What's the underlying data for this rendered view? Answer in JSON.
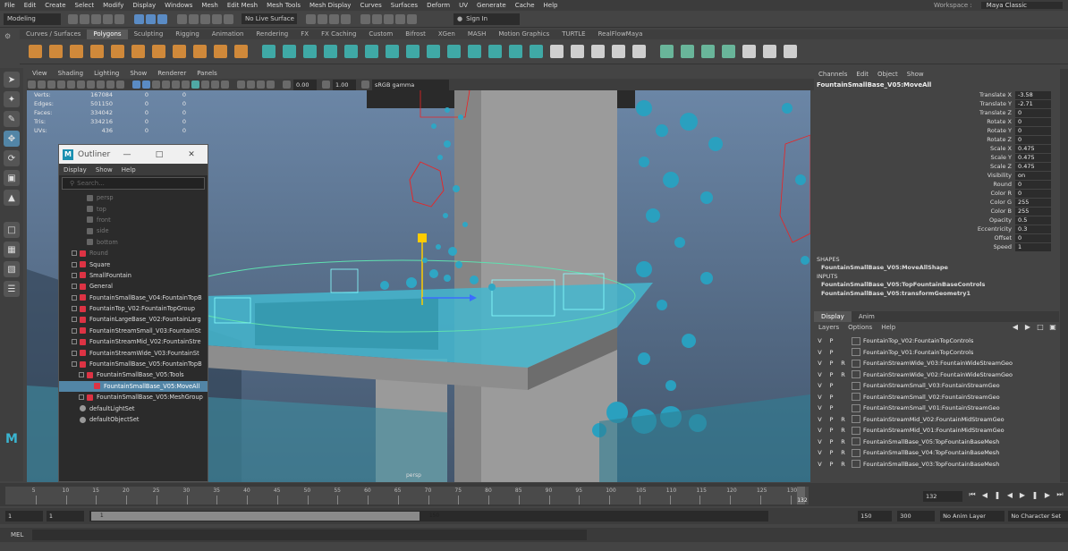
{
  "menubar": {
    "items": [
      "File",
      "Edit",
      "Create",
      "Select",
      "Modify",
      "Display",
      "Windows",
      "Mesh",
      "Edit Mesh",
      "Mesh Tools",
      "Mesh Display",
      "Curves",
      "Surfaces",
      "Deform",
      "UV",
      "Generate",
      "Cache",
      "Help"
    ],
    "workspace_label": "Workspace :",
    "workspace_value": "Maya Classic"
  },
  "statusline": {
    "mode": "Modeling",
    "live_surface": "No Live Surface",
    "sign_in": "Sign In"
  },
  "shelf": {
    "tabs": [
      "Curves / Surfaces",
      "Polygons",
      "Sculpting",
      "Rigging",
      "Animation",
      "Rendering",
      "FX",
      "FX Caching",
      "Custom",
      "Bifrost",
      "XGen",
      "MASH",
      "Motion Graphics",
      "TURTLE",
      "RealFlowMaya"
    ],
    "active_tab": "Polygons"
  },
  "viewport": {
    "menu": [
      "View",
      "Shading",
      "Lighting",
      "Show",
      "Renderer",
      "Panels"
    ],
    "field_a": "0.00",
    "field_b": "1.00",
    "colorspace": "sRGB gamma",
    "camera_label": "persp",
    "hud": [
      {
        "label": "Verts:",
        "a": "167084",
        "b": "0",
        "c": "0"
      },
      {
        "label": "Edges:",
        "a": "501150",
        "b": "0",
        "c": "0"
      },
      {
        "label": "Faces:",
        "a": "334042",
        "b": "0",
        "c": "0"
      },
      {
        "label": "Tris:",
        "a": "334216",
        "b": "0",
        "c": "0"
      },
      {
        "label": "UVs:",
        "a": "436",
        "b": "0",
        "c": "0"
      }
    ]
  },
  "outliner": {
    "title": "Outliner",
    "menu": [
      "Display",
      "Show",
      "Help"
    ],
    "search_placeholder": "Search...",
    "items": [
      {
        "label": "persp",
        "type": "cam",
        "dim": true,
        "indent": 1
      },
      {
        "label": "top",
        "type": "cam",
        "dim": true,
        "indent": 1
      },
      {
        "label": "front",
        "type": "cam",
        "dim": true,
        "indent": 1
      },
      {
        "label": "side",
        "type": "cam",
        "dim": true,
        "indent": 1
      },
      {
        "label": "bottom",
        "type": "cam",
        "dim": true,
        "indent": 1
      },
      {
        "label": "Round",
        "type": "grp",
        "dim": true,
        "indent": 0
      },
      {
        "label": "Square",
        "type": "grp",
        "dim": false,
        "indent": 0
      },
      {
        "label": "SmallFountain",
        "type": "grp",
        "dim": false,
        "indent": 0
      },
      {
        "label": "General",
        "type": "grp",
        "dim": false,
        "indent": 0
      },
      {
        "label": "FountainSmallBase_V04:FountainTopB",
        "type": "grp",
        "dim": false,
        "indent": 0
      },
      {
        "label": "FountainTop_V02:FountainTopGroup",
        "type": "grp",
        "dim": false,
        "indent": 0
      },
      {
        "label": "FountainLargeBase_V02:FountainLarg",
        "type": "grp",
        "dim": false,
        "indent": 0
      },
      {
        "label": "FountainStreamSmall_V03:FountainSt",
        "type": "grp",
        "dim": false,
        "indent": 0
      },
      {
        "label": "FountainStreamMid_V02:FountainStre",
        "type": "grp",
        "dim": false,
        "indent": 0
      },
      {
        "label": "FountainStreamWide_V03:FountainSt",
        "type": "grp",
        "dim": false,
        "indent": 0
      },
      {
        "label": "FountainSmallBase_V05:FountainTopB",
        "type": "grp",
        "dim": false,
        "indent": 0
      },
      {
        "label": "FountainSmallBase_V05:Tools",
        "type": "grp",
        "dim": false,
        "indent": 1
      },
      {
        "label": "FountainSmallBase_V05:MoveAll",
        "type": "tool",
        "dim": false,
        "indent": 2,
        "selected": true
      },
      {
        "label": "FountainSmallBase_V05:MeshGroup",
        "type": "grp",
        "dim": false,
        "indent": 1
      },
      {
        "label": "defaultLightSet",
        "type": "set",
        "dim": false,
        "indent": 0
      },
      {
        "label": "defaultObjectSet",
        "type": "set",
        "dim": false,
        "indent": 0
      }
    ]
  },
  "channelbox": {
    "menu": [
      "Channels",
      "Edit",
      "Object",
      "Show"
    ],
    "object_name": "FountainSmallBase_V05:MoveAll",
    "attributes": [
      {
        "name": "Translate X",
        "value": "-3.58"
      },
      {
        "name": "Translate Y",
        "value": "-2.71"
      },
      {
        "name": "Translate Z",
        "value": "0"
      },
      {
        "name": "Rotate X",
        "value": "0"
      },
      {
        "name": "Rotate Y",
        "value": "0"
      },
      {
        "name": "Rotate Z",
        "value": "0"
      },
      {
        "name": "Scale X",
        "value": "0.475"
      },
      {
        "name": "Scale Y",
        "value": "0.475"
      },
      {
        "name": "Scale Z",
        "value": "0.475"
      },
      {
        "name": "Visibility",
        "value": "on"
      },
      {
        "name": "Round",
        "value": "0"
      },
      {
        "name": "Color R",
        "value": "0"
      },
      {
        "name": "Color G",
        "value": "255"
      },
      {
        "name": "Color B",
        "value": "255"
      },
      {
        "name": "Opacity",
        "value": "0.5"
      },
      {
        "name": "Eccentricity",
        "value": "0.3"
      },
      {
        "name": "Offset",
        "value": "0"
      },
      {
        "name": "Speed",
        "value": "1"
      }
    ],
    "shapes_header": "SHAPES",
    "shape": "FountainSmallBase_V05:MoveAllShape",
    "inputs_header": "INPUTS",
    "inputs": [
      "FountainSmallBase_V05:TopFountainBaseControls",
      "FountainSmallBase_V05:transformGeometry1"
    ]
  },
  "layer_editor": {
    "tabs": [
      "Display",
      "Anim"
    ],
    "active_tab": "Display",
    "menu": [
      "Layers",
      "Options",
      "Help"
    ],
    "layers": [
      {
        "v": "V",
        "p": "P",
        "r": "",
        "name": "FountainTop_V02:FountainTopControls"
      },
      {
        "v": "V",
        "p": "P",
        "r": "",
        "name": "FountainTop_V01:FountainTopControls"
      },
      {
        "v": "V",
        "p": "P",
        "r": "R",
        "name": "FountainStreamWide_V03:FountainWideStreamGeo"
      },
      {
        "v": "V",
        "p": "P",
        "r": "R",
        "name": "FountainStreamWide_V02:FountainWideStreamGeo"
      },
      {
        "v": "V",
        "p": "P",
        "r": "",
        "name": "FountainStreamSmall_V03:FountainStreamGeo"
      },
      {
        "v": "V",
        "p": "P",
        "r": "",
        "name": "FountainStreamSmall_V02:FountainStreamGeo"
      },
      {
        "v": "V",
        "p": "P",
        "r": "",
        "name": "FountainStreamSmall_V01:FountainStreamGeo"
      },
      {
        "v": "V",
        "p": "P",
        "r": "R",
        "name": "FountainStreamMid_V02:FountainMidStreamGeo"
      },
      {
        "v": "V",
        "p": "P",
        "r": "R",
        "name": "FountainStreamMid_V01:FountainMidStreamGeo"
      },
      {
        "v": "V",
        "p": "P",
        "r": "R",
        "name": "FountainSmallBase_V05:TopFountainBaseMesh"
      },
      {
        "v": "V",
        "p": "P",
        "r": "R",
        "name": "FountainSmallBase_V04:TopFountainBaseMesh"
      },
      {
        "v": "V",
        "p": "P",
        "r": "R",
        "name": "FountainSmallBase_V03:TopFountainBaseMesh"
      }
    ]
  },
  "timeline": {
    "ticks": [
      "5",
      "10",
      "15",
      "20",
      "25",
      "30",
      "35",
      "40",
      "45",
      "50",
      "55",
      "60",
      "65",
      "70",
      "75",
      "80",
      "85",
      "90",
      "95",
      "100",
      "105",
      "110",
      "115",
      "120",
      "125",
      "130"
    ],
    "current_frame": "132",
    "current_frame_field": "132"
  },
  "range": {
    "start": "1",
    "playback_start": "1",
    "slider_start": "1",
    "slider_end": "150",
    "playback_end": "150",
    "end": "300",
    "anim_layer": "No Anim Layer",
    "character_set": "No Character Set"
  },
  "commandline": {
    "label": "MEL"
  }
}
